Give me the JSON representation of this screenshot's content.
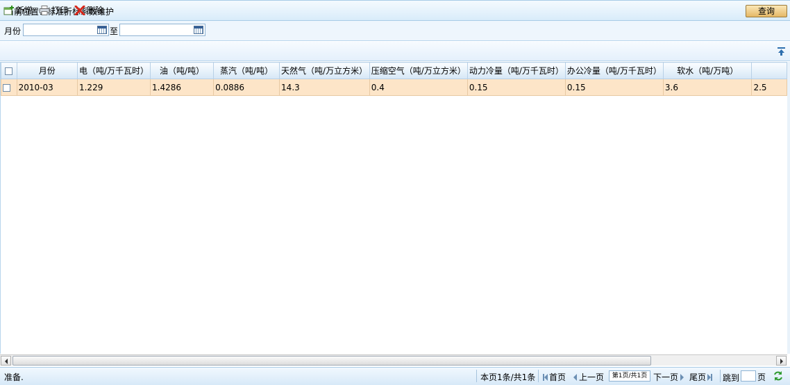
{
  "header": {
    "breadcrumb": "当前位置：标准折标系数维护",
    "query_button": "查询"
  },
  "filter": {
    "month_label": "月份",
    "to_label": "至",
    "from_value": "",
    "to_value": ""
  },
  "toolbar": {
    "add_label": "新增",
    "print_label": "打印",
    "delete_label": "删除"
  },
  "grid": {
    "columns": [
      "月份",
      "电（吨/万千瓦时）",
      "油（吨/吨）",
      "蒸汽（吨/吨）",
      "天然气（吨/万立方米）",
      "压缩空气（吨/万立方米）",
      "动力冷量（吨/万千瓦时）",
      "办公冷量（吨/万千瓦时）",
      "软水（吨/万吨）",
      ""
    ],
    "rows": [
      [
        "2010-03",
        "1.229",
        "1.4286",
        "0.0886",
        "14.3",
        "0.4",
        "0.15",
        "0.15",
        "3.6",
        "2.5"
      ]
    ]
  },
  "status": {
    "ready": "准备.",
    "page_info": "本页1条/共1条",
    "first": "首页",
    "prev": "上一页",
    "page_box": "第1页/共1页",
    "next": "下一页",
    "last": "尾页",
    "jump": "跳到",
    "page_unit": "页",
    "jump_value": ""
  },
  "colors": {
    "row_selected": "#fde5c8",
    "header_bg": "#d6e7f6",
    "query_button": "#e5b866",
    "delete_icon": "#d8261a"
  }
}
